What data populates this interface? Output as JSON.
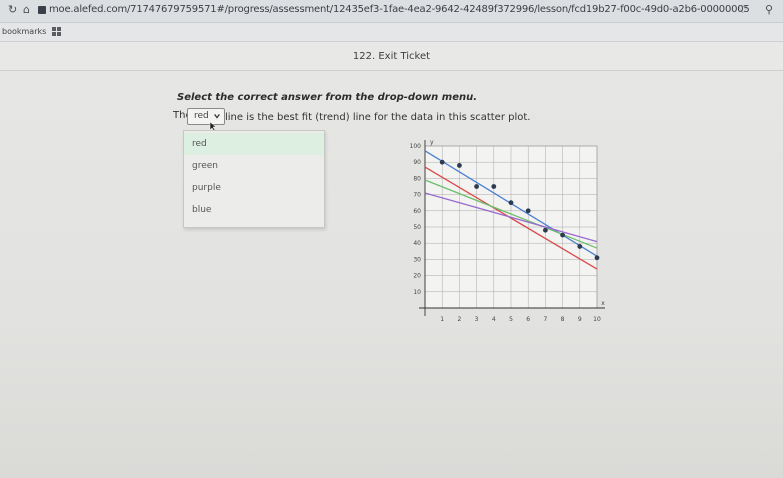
{
  "browser": {
    "url": "moe.alefed.com/7174767975957​1#/progress/assessment/12435ef3-1fae-4ea2-9642-42489f372996/lesson/fcd19b27-f00c-49d0-a2b6-000000057...",
    "bookmarks_label": "bookmarks"
  },
  "page": {
    "title": "122. Exit Ticket"
  },
  "question": {
    "instruction": "Select the correct answer from the drop-down menu.",
    "sentence_before": "The",
    "sentence_after": "line is the best fit (trend) line for the data in this scatter plot.",
    "selected_value": "red",
    "options": [
      "red",
      "green",
      "purple",
      "blue"
    ]
  },
  "chart_data": {
    "type": "scatter",
    "xlabel": "x",
    "ylabel": "y",
    "xlim": [
      0,
      10
    ],
    "ylim": [
      0,
      100
    ],
    "x_ticks": [
      "1",
      "2",
      "3",
      "4",
      "5",
      "6",
      "7",
      "8",
      "9",
      "10"
    ],
    "y_ticks": [
      "10",
      "20",
      "30",
      "40",
      "50",
      "60",
      "70",
      "80",
      "90",
      "100"
    ],
    "points": [
      {
        "x": 1,
        "y": 90
      },
      {
        "x": 2,
        "y": 88
      },
      {
        "x": 3,
        "y": 75
      },
      {
        "x": 4,
        "y": 75
      },
      {
        "x": 5,
        "y": 65
      },
      {
        "x": 6,
        "y": 60
      },
      {
        "x": 7,
        "y": 48
      },
      {
        "x": 8,
        "y": 45
      },
      {
        "x": 9,
        "y": 38
      },
      {
        "x": 10,
        "y": 31
      }
    ],
    "lines": [
      {
        "color": "#4a7fd0",
        "x1": 0,
        "y1": 97,
        "x2": 10,
        "y2": 32
      },
      {
        "color": "#d94a4a",
        "x1": 0,
        "y1": 87,
        "x2": 10,
        "y2": 24
      },
      {
        "color": "#6cbf6c",
        "x1": 0,
        "y1": 79,
        "x2": 10,
        "y2": 37
      },
      {
        "color": "#9a6ad0",
        "x1": 0,
        "y1": 71,
        "x2": 10,
        "y2": 41
      }
    ],
    "point_color": "#2d3b4e",
    "grid": true
  }
}
